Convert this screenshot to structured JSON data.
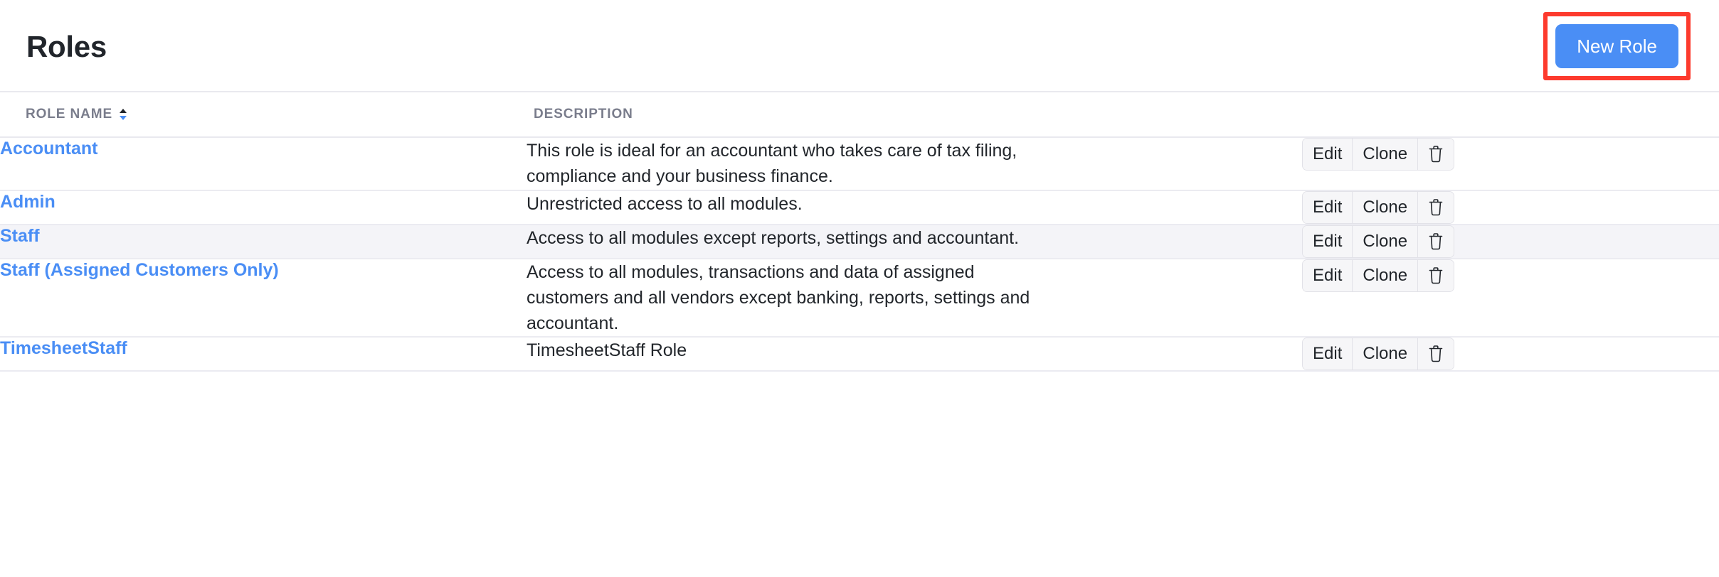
{
  "header": {
    "title": "Roles",
    "new_role_label": "New Role",
    "highlight_color": "#fd3a2d",
    "accent_color": "#4a8ef5"
  },
  "table": {
    "columns": [
      {
        "key": "role_name",
        "label": "Role Name",
        "sortable": true,
        "sort_icon": "sort-updown-icon"
      },
      {
        "key": "description",
        "label": "Description",
        "sortable": false
      },
      {
        "key": "actions",
        "label": "",
        "sortable": false
      }
    ],
    "actions": {
      "edit_label": "Edit",
      "clone_label": "Clone",
      "delete_icon": "trash-icon"
    },
    "rows": [
      {
        "name": "Accountant",
        "description": "This role is ideal for an accountant who takes care of tax filing, compliance and your business finance.",
        "highlighted": false
      },
      {
        "name": "Admin",
        "description": "Unrestricted access to all modules.",
        "highlighted": false
      },
      {
        "name": "Staff",
        "description": "Access to all modules except reports, settings and accountant.",
        "highlighted": true
      },
      {
        "name": "Staff (Assigned Customers Only)",
        "description": "Access to all modules, transactions and data of assigned customers and all vendors except banking, reports, settings and accountant.",
        "highlighted": false
      },
      {
        "name": "TimesheetStaff",
        "description": "TimesheetStaff Role",
        "highlighted": false
      }
    ]
  }
}
